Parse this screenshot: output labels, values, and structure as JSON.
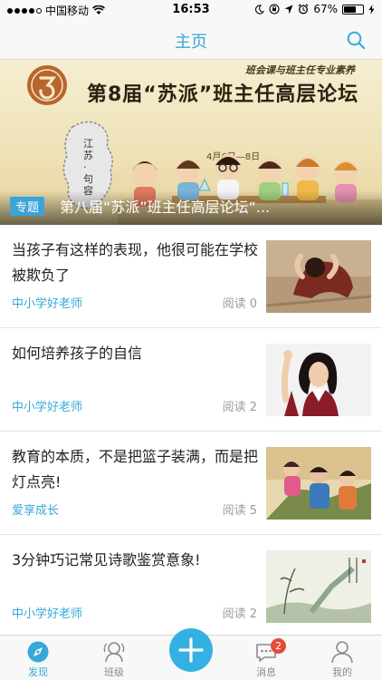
{
  "status_bar": {
    "carrier": "中国移动",
    "time": "16:53",
    "battery": "67%",
    "battery_level": 0.67,
    "icons": [
      "signal-dots-icon",
      "wifi-icon",
      "moon-icon",
      "lock-rotation-icon",
      "location-icon",
      "alarm-icon",
      "battery-icon",
      "charging-icon"
    ]
  },
  "nav": {
    "title": "主页",
    "search_icon": "search-icon"
  },
  "banner": {
    "tag": "专题",
    "caption": "第八届“苏派”班主任高层论坛“...",
    "headline": "第8届“苏派”班主任高层论坛",
    "subline": "班会课与班主任专业素养",
    "map_text": "江苏·句容",
    "date_text": "4月6日—8日"
  },
  "feed": {
    "items": [
      {
        "title": "当孩子有这样的表现，他很可能在学校被欺负了",
        "source": "中小学好老师",
        "read": "阅读 0"
      },
      {
        "title": "如何培养孩子的自信",
        "source": "中小学好老师",
        "read": "阅读 2"
      },
      {
        "title": "教育的本质，不是把篮子装满，而是把灯点亮!",
        "source": "爱享成长",
        "read": "阅读 5"
      },
      {
        "title": "3分钟巧记常见诗歌鉴赏意象!",
        "source": "中小学好老师",
        "read": "阅读 2"
      }
    ]
  },
  "tab_bar": {
    "tabs": [
      {
        "label": "发现",
        "icon": "discover-icon"
      },
      {
        "label": "班级",
        "icon": "class-icon"
      },
      {
        "label": "",
        "icon": "plus-icon"
      },
      {
        "label": "消息",
        "icon": "message-icon",
        "badge": "2"
      },
      {
        "label": "我的",
        "icon": "profile-icon"
      }
    ]
  },
  "colors": {
    "accent": "#36a9d9",
    "badge": "#e64a3a",
    "tag_bg": "#3aa3d8"
  }
}
